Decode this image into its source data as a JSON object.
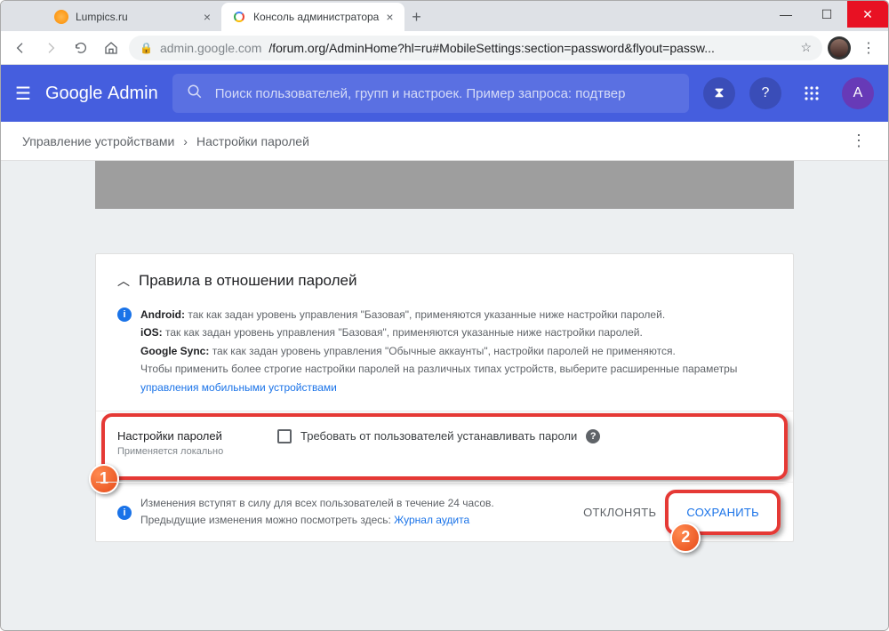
{
  "window": {
    "min": "—",
    "max": "☐",
    "close": "✕"
  },
  "tabs": {
    "items": [
      {
        "label": "Lumpics.ru"
      },
      {
        "label": "Консоль администратора"
      }
    ],
    "newtab": "+"
  },
  "addressbar": {
    "host": "admin.google.com",
    "path": "/forum.org/AdminHome?hl=ru#MobileSettings:section=password&flyout=passw...",
    "star": "☆",
    "menu": "⋮"
  },
  "header": {
    "logo_a": "Google ",
    "logo_b": "Admin",
    "search_placeholder": "Поиск пользователей, групп и настроек. Пример запроса: подтвер",
    "hourglass": "⧗",
    "help": "?",
    "avatar": "A"
  },
  "breadcrumb": {
    "a": "Управление устройствами",
    "sep": "›",
    "b": "Настройки паролей",
    "more": "⋮"
  },
  "card": {
    "title": "Правила в отношении паролей",
    "info": {
      "line1_b": "Android: ",
      "line1": "так как задан уровень управления \"Базовая\", применяются указанные ниже настройки паролей.",
      "line2_b": "iOS: ",
      "line2": "так как задан уровень управления \"Базовая\", применяются указанные ниже настройки паролей.",
      "line3_b": "Google Sync: ",
      "line3": "так как задан уровень управления \"Обычные аккаунты\", настройки паролей не применяются.",
      "line4": "Чтобы применить более строгие настройки паролей на различных типах устройств, выберите расширенные параметры ",
      "link": "управления мобильными устройствами"
    },
    "settings": {
      "title": "Настройки паролей",
      "sub": "Применяется локально",
      "checkbox_label": "Требовать от пользователей устанавливать пароли",
      "help": "?"
    },
    "footer": {
      "line1": "Изменения вступят в силу для всех пользователей в течение 24 часов.",
      "line2_a": "Предыдущие изменения можно посмотреть здесь: ",
      "line2_link": "Журнал аудита",
      "cancel": "ОТКЛОНЯТЬ",
      "save": "СОХРАНИТЬ"
    },
    "info_i": "i"
  },
  "anno": {
    "one": "1",
    "two": "2"
  }
}
